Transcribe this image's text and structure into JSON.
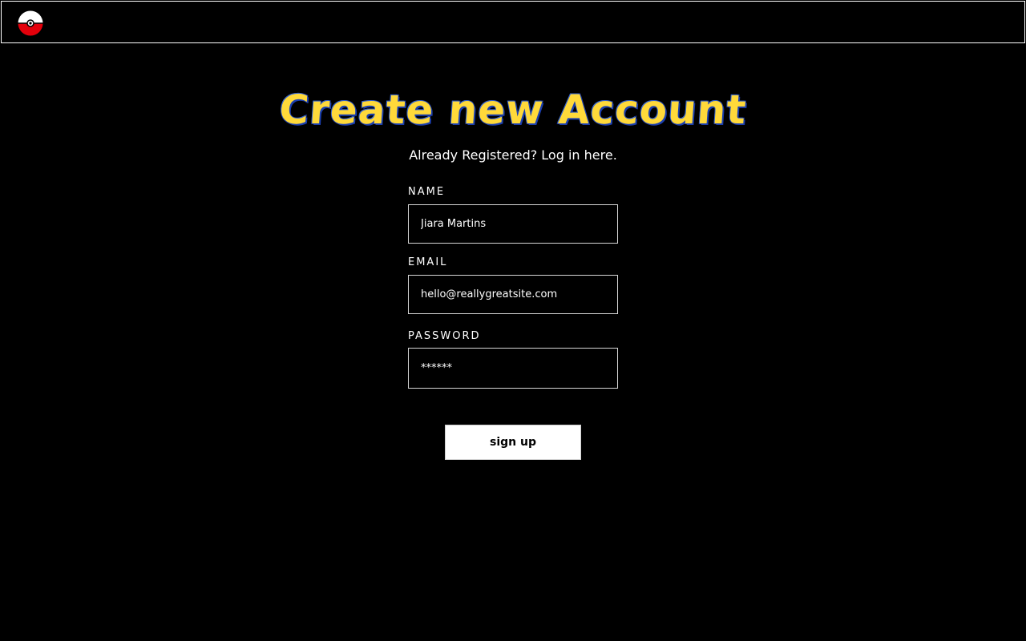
{
  "header": {
    "logo_icon": "pokeball-icon"
  },
  "page": {
    "title": "Create new Account",
    "login_link": "Already Registered? Log in here."
  },
  "form": {
    "name_label": "NAME",
    "name_value": "Jiara Martins",
    "email_label": "EMAIL",
    "email_value": "hello@reallygreatsite.com",
    "password_label": "PASSWORD",
    "password_value": "******",
    "submit_label": "sign up"
  },
  "colors": {
    "background": "#000000",
    "title_fill": "#ffd93a",
    "title_outline": "#1b3fb0",
    "button_bg": "#ffffff",
    "pokeball_red": "#e3000b"
  }
}
